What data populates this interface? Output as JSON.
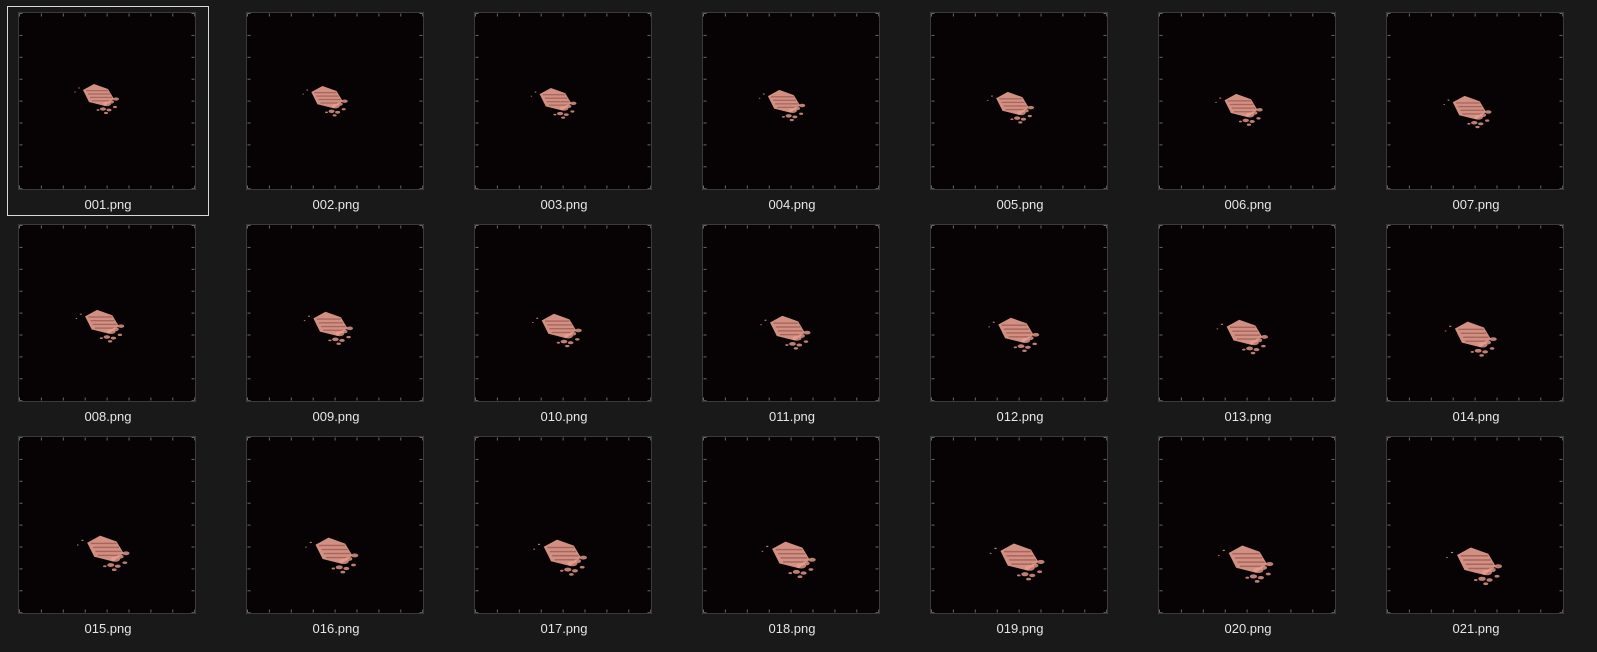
{
  "files": [
    {
      "name": "001.png",
      "selected": true
    },
    {
      "name": "002.png",
      "selected": false
    },
    {
      "name": "003.png",
      "selected": false
    },
    {
      "name": "004.png",
      "selected": false
    },
    {
      "name": "005.png",
      "selected": false
    },
    {
      "name": "006.png",
      "selected": false
    },
    {
      "name": "007.png",
      "selected": false
    },
    {
      "name": "008.png",
      "selected": false
    },
    {
      "name": "009.png",
      "selected": false
    },
    {
      "name": "010.png",
      "selected": false
    },
    {
      "name": "011.png",
      "selected": false
    },
    {
      "name": "012.png",
      "selected": false
    },
    {
      "name": "013.png",
      "selected": false
    },
    {
      "name": "014.png",
      "selected": false
    },
    {
      "name": "015.png",
      "selected": false
    },
    {
      "name": "016.png",
      "selected": false
    },
    {
      "name": "017.png",
      "selected": false
    },
    {
      "name": "018.png",
      "selected": false
    },
    {
      "name": "019.png",
      "selected": false
    },
    {
      "name": "020.png",
      "selected": false
    },
    {
      "name": "021.png",
      "selected": false
    }
  ],
  "colors": {
    "background": "#191919",
    "thumb_background": "#070203",
    "blob": "#e8a090",
    "label": "#e6e6e6",
    "selection_border": "#d9d9d9"
  }
}
